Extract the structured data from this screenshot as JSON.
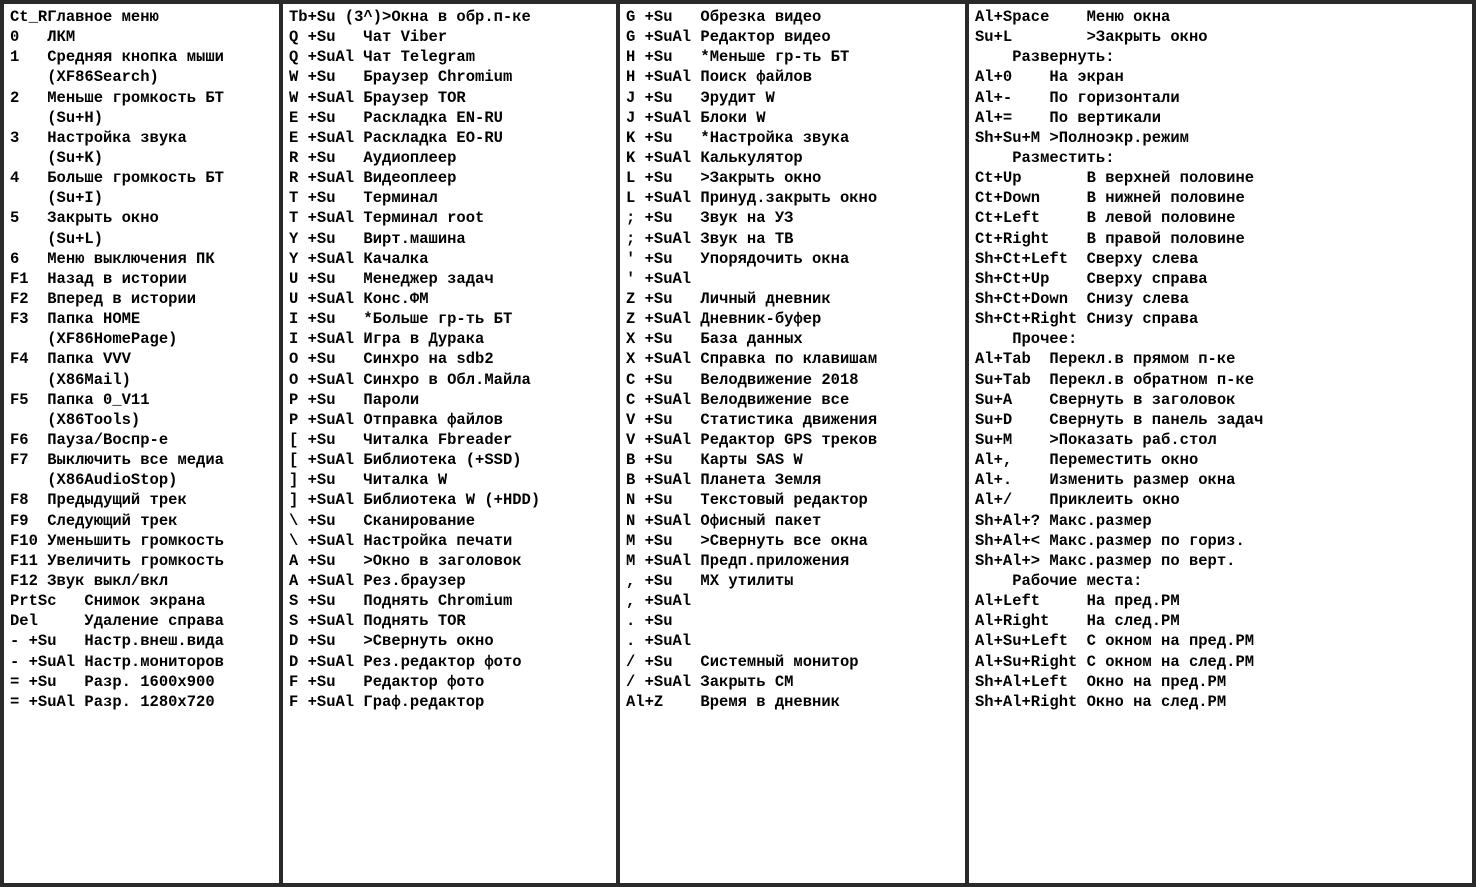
{
  "panel1": [
    {
      "k": "Ct_R",
      "v": "Главное меню"
    },
    {
      "k": "0",
      "v": "ЛКМ"
    },
    {
      "k": "1",
      "v": "Средняя кнопка мыши"
    },
    {
      "k": "",
      "v": "(XF86Search)"
    },
    {
      "k": "2",
      "v": "Меньше громкость БТ"
    },
    {
      "k": "",
      "v": "(Su+H)"
    },
    {
      "k": "3",
      "v": "Настройка звука"
    },
    {
      "k": "",
      "v": "(Su+K)"
    },
    {
      "k": "4",
      "v": "Больше громкость БТ"
    },
    {
      "k": "",
      "v": "(Su+I)"
    },
    {
      "k": "5",
      "v": "Закрыть окно"
    },
    {
      "k": "",
      "v": "(Su+L)"
    },
    {
      "k": "6",
      "v": "Меню выключения ПК"
    },
    {
      "k": "F1",
      "v": "Назад в истории"
    },
    {
      "k": "F2",
      "v": "Вперед в истории"
    },
    {
      "k": "F3",
      "v": "Папка HOME"
    },
    {
      "k": "",
      "v": "(XF86HomePage)"
    },
    {
      "k": "F4",
      "v": "Папка VVV"
    },
    {
      "k": "",
      "v": "(X86Mail)"
    },
    {
      "k": "F5",
      "v": "Папка 0_V11"
    },
    {
      "k": "",
      "v": "(X86Tools)"
    },
    {
      "k": "F6",
      "v": "Пауза/Воспр-е"
    },
    {
      "k": "F7",
      "v": "Выключить все медиа"
    },
    {
      "k": "",
      "v": "(X86AudioStop)"
    },
    {
      "k": "F8",
      "v": "Предыдущий трек"
    },
    {
      "k": "F9",
      "v": "Следующий трек"
    },
    {
      "k": "F10",
      "v": "Уменьшить громкость"
    },
    {
      "k": "F11",
      "v": "Увеличить громкость"
    },
    {
      "k": "F12",
      "v": "Звук выкл/вкл"
    },
    {
      "k": "PrtSc",
      "v": "Снимок экрана",
      "kw": 8
    },
    {
      "k": "Del",
      "v": "Удаление справа",
      "kw": 8
    },
    {
      "k": "- +Su",
      "v": "Настр.внеш.вида",
      "kw": 8
    },
    {
      "k": "- +SuAl",
      "v": "Настр.мониторов",
      "kw": 8
    },
    {
      "k": "= +Su",
      "v": "Разр. 1600x900",
      "kw": 8
    },
    {
      "k": "= +SuAl",
      "v": "Разр. 1280x720",
      "kw": 8
    }
  ],
  "panel2": [
    {
      "k": "Tb+Su (3^)",
      "v": ">Окна в обр.п-ке",
      "kw": 10
    },
    {
      "k": "Q +Su",
      "v": "Чат Viber"
    },
    {
      "k": "Q +SuAl",
      "v": "Чат Telegram"
    },
    {
      "k": "W +Su",
      "v": "Браузер Chromium"
    },
    {
      "k": "W +SuAl",
      "v": "Браузер TOR"
    },
    {
      "k": "E +Su",
      "v": "Раскладка EN-RU"
    },
    {
      "k": "E +SuAl",
      "v": "Раскладка EO-RU"
    },
    {
      "k": "R +Su",
      "v": "Аудиоплеер"
    },
    {
      "k": "R +SuAl",
      "v": "Видеоплеер"
    },
    {
      "k": "T +Su",
      "v": "Терминал"
    },
    {
      "k": "T +SuAl",
      "v": "Терминал root"
    },
    {
      "k": "Y +Su",
      "v": "Вирт.машина"
    },
    {
      "k": "Y +SuAl",
      "v": "Качалка"
    },
    {
      "k": "U +Su",
      "v": "Менеджер задач"
    },
    {
      "k": "U +SuAl",
      "v": "Конс.ФМ"
    },
    {
      "k": "I +Su",
      "v": "*Больше гр-ть БТ"
    },
    {
      "k": "I +SuAl",
      "v": "Игра в Дурака"
    },
    {
      "k": "O +Su",
      "v": "Синхро на sdb2"
    },
    {
      "k": "O +SuAl",
      "v": "Синхро в Обл.Майла"
    },
    {
      "k": "P +Su",
      "v": "Пароли"
    },
    {
      "k": "P +SuAl",
      "v": "Отправка файлов"
    },
    {
      "k": "[ +Su",
      "v": "Читалка Fbreader"
    },
    {
      "k": "[ +SuAl",
      "v": "Библиотека (+SSD)"
    },
    {
      "k": "] +Su",
      "v": "Читалка W"
    },
    {
      "k": "] +SuAl",
      "v": "Библиотека W (+HDD)"
    },
    {
      "k": "\\ +Su",
      "v": "Сканирование"
    },
    {
      "k": "\\ +SuAl",
      "v": "Настройка печати"
    },
    {
      "k": "A +Su",
      "v": ">Окно в заголовок"
    },
    {
      "k": "A +SuAl",
      "v": "Рез.браузер"
    },
    {
      "k": "S +Su",
      "v": "Поднять Chromium"
    },
    {
      "k": "S +SuAl",
      "v": "Поднять TOR"
    },
    {
      "k": "D +Su",
      "v": ">Свернуть окно"
    },
    {
      "k": "D +SuAl",
      "v": "Рез.редактор фото"
    },
    {
      "k": "F +Su",
      "v": "Редактор фото"
    },
    {
      "k": "F +SuAl",
      "v": "Граф.редактор"
    }
  ],
  "panel3": [
    {
      "k": "G +Su",
      "v": "Обрезка видео"
    },
    {
      "k": "G +SuAl",
      "v": "Редактор видео"
    },
    {
      "k": "H +Su",
      "v": "*Меньше гр-ть БТ"
    },
    {
      "k": "H +SuAl",
      "v": "Поиск файлов"
    },
    {
      "k": "J +Su",
      "v": "Эрудит W"
    },
    {
      "k": "J +SuAl",
      "v": "Блоки W"
    },
    {
      "k": "K +Su",
      "v": "*Настройка звука"
    },
    {
      "k": "K +SuAl",
      "v": "Калькулятор"
    },
    {
      "k": "L +Su",
      "v": ">Закрыть окно"
    },
    {
      "k": "L +SuAl",
      "v": "Принуд.закрыть окно"
    },
    {
      "k": "; +Su",
      "v": "Звук на УЗ"
    },
    {
      "k": "; +SuAl",
      "v": "Звук на ТВ"
    },
    {
      "k": "' +Su",
      "v": "Упорядочить окна"
    },
    {
      "k": "' +SuAl",
      "v": ""
    },
    {
      "k": "Z +Su",
      "v": "Личный дневник"
    },
    {
      "k": "Z +SuAl",
      "v": "Дневник-буфер"
    },
    {
      "k": "X +Su",
      "v": "База данных"
    },
    {
      "k": "X +SuAl",
      "v": "Справка по клавишам"
    },
    {
      "k": "C +Su",
      "v": "Велодвижение 2018"
    },
    {
      "k": "C +SuAl",
      "v": "Велодвижение все"
    },
    {
      "k": "V +Su",
      "v": "Статистика движения"
    },
    {
      "k": "V +SuAl",
      "v": "Редактор GPS треков"
    },
    {
      "k": "B +Su",
      "v": "Карты SAS W"
    },
    {
      "k": "B +SuAl",
      "v": "Планета Земля"
    },
    {
      "k": "N +Su",
      "v": "Текстовый редактор"
    },
    {
      "k": "N +SuAl",
      "v": "Офисный пакет"
    },
    {
      "k": "M +Su",
      "v": ">Свернуть все окна"
    },
    {
      "k": "M +SuAl",
      "v": "Предп.приложения"
    },
    {
      "k": ", +Su",
      "v": "MX утилиты"
    },
    {
      "k": ", +SuAl",
      "v": ""
    },
    {
      "k": ". +Su",
      "v": ""
    },
    {
      "k": ". +SuAl",
      "v": ""
    },
    {
      "k": "/ +Su",
      "v": "Системный монитор"
    },
    {
      "k": "/ +SuAl",
      "v": "Закрыть СМ"
    },
    {
      "k": "Al+Z",
      "v": "Время в дневник"
    }
  ],
  "panel4": [
    {
      "k": "Al+Space",
      "v": "Меню окна",
      "kw": 12
    },
    {
      "k": "Su+L",
      "v": ">Закрыть окно",
      "kw": 12
    },
    {
      "k": "",
      "v": "Развернуть:",
      "center": 1
    },
    {
      "k": "Al+0",
      "v": "На экран",
      "kw": 8
    },
    {
      "k": "Al+-",
      "v": "По горизонтали",
      "kw": 8
    },
    {
      "k": "Al+=",
      "v": "По вертикали",
      "kw": 8
    },
    {
      "k": "Sh+Su+M",
      "v": ">Полноэкр.режим",
      "kw": 8
    },
    {
      "k": "",
      "v": "Разместить:",
      "center": 1
    },
    {
      "k": "Ct+Up",
      "v": "В верхней половине",
      "kw": 12
    },
    {
      "k": "Ct+Down",
      "v": "В нижней половине",
      "kw": 12
    },
    {
      "k": "Ct+Left",
      "v": "В левой половине",
      "kw": 12
    },
    {
      "k": "Ct+Right",
      "v": "В правой половине",
      "kw": 12
    },
    {
      "k": "Sh+Ct+Left",
      "v": "Сверху слева",
      "kw": 12
    },
    {
      "k": "Sh+Ct+Up",
      "v": "Сверху справа",
      "kw": 12
    },
    {
      "k": "Sh+Ct+Down",
      "v": "Снизу слева",
      "kw": 12
    },
    {
      "k": "Sh+Ct+Right",
      "v": "Снизу справа",
      "kw": 12
    },
    {
      "k": "",
      "v": "Прочее:",
      "center": 1
    },
    {
      "k": "Al+Tab",
      "v": "Перекл.в прямом п-ке",
      "kw": 8
    },
    {
      "k": "Su+Tab",
      "v": "Перекл.в обратном п-ке",
      "kw": 8
    },
    {
      "k": "Su+A",
      "v": "Свернуть в заголовок",
      "kw": 8
    },
    {
      "k": "Su+D",
      "v": "Свернуть в панель задач",
      "kw": 8
    },
    {
      "k": "Su+M",
      "v": ">Показать раб.стол",
      "kw": 8
    },
    {
      "k": "Al+,",
      "v": "Переместить окно",
      "kw": 8
    },
    {
      "k": "Al+.",
      "v": "Изменить размер окна",
      "kw": 8
    },
    {
      "k": "Al+/",
      "v": "Приклеить окно",
      "kw": 8
    },
    {
      "k": "Sh+Al+?",
      "v": "Макс.размер",
      "kw": 8
    },
    {
      "k": "Sh+Al+<",
      "v": "Макс.размер по гориз.",
      "kw": 8
    },
    {
      "k": "Sh+Al+>",
      "v": "Макс.размер по верт.",
      "kw": 8
    },
    {
      "k": "",
      "v": "Рабочие места:",
      "center": 1
    },
    {
      "k": "Al+Left",
      "v": "На пред.РМ",
      "kw": 12
    },
    {
      "k": "Al+Right",
      "v": "На след.РМ",
      "kw": 12
    },
    {
      "k": "Al+Su+Left",
      "v": "С окном на пред.РМ",
      "kw": 12
    },
    {
      "k": "Al+Su+Right",
      "v": "С окном на след.РМ",
      "kw": 12
    },
    {
      "k": "Sh+Al+Left",
      "v": "Окно на пред.РМ",
      "kw": 12
    },
    {
      "k": "Sh+Al+Right",
      "v": "Окно на след.РМ",
      "kw": 12
    }
  ],
  "defaults": {
    "panel1_kw": 4,
    "panel2_kw": 8,
    "panel3_kw": 8,
    "panel4_kw": 12
  }
}
